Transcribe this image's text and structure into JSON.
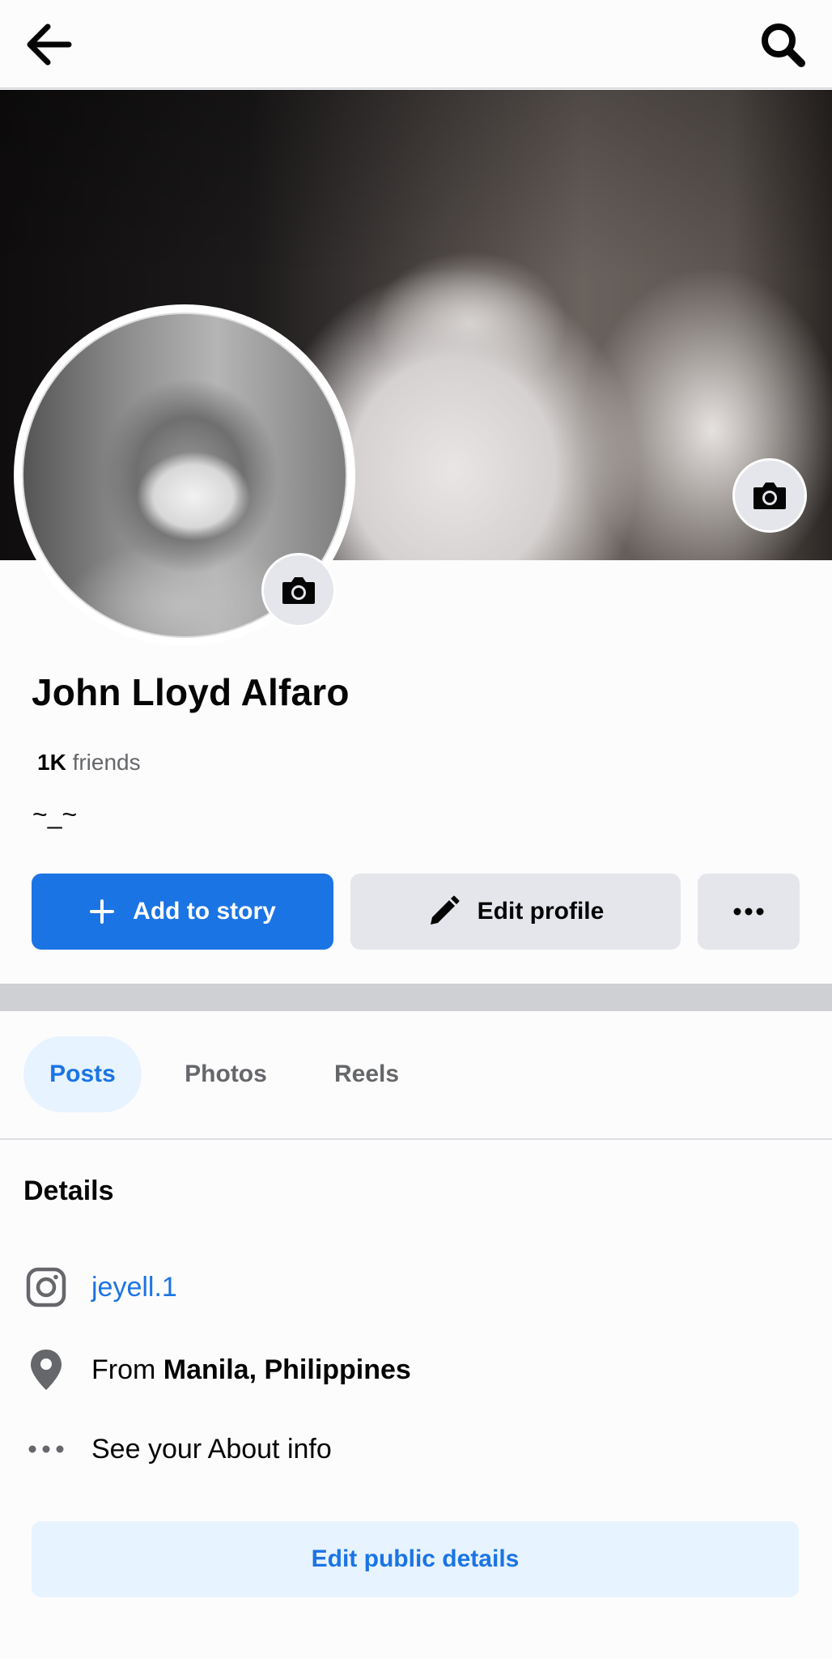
{
  "topbar": {
    "back_icon": "arrow-left-icon",
    "search_icon": "search-icon"
  },
  "profile": {
    "name": "John Lloyd Alfaro",
    "friends_count": "1K",
    "friends_label": " friends",
    "bio": "~_~"
  },
  "actions": {
    "add_story": "Add to story",
    "edit_profile": "Edit profile"
  },
  "tabs": [
    {
      "label": "Posts",
      "active": true
    },
    {
      "label": "Photos",
      "active": false
    },
    {
      "label": "Reels",
      "active": false
    }
  ],
  "details": {
    "title": "Details",
    "instagram": "jeyell.1",
    "from_prefix": "From ",
    "from_place": "Manila, Philippines",
    "about": "See your About info",
    "edit_public": "Edit public details"
  },
  "colors": {
    "accent": "#1b74e4",
    "accent_light": "#e7f3ff",
    "button_gray": "#e4e6eb",
    "muted_text": "#65676b"
  }
}
